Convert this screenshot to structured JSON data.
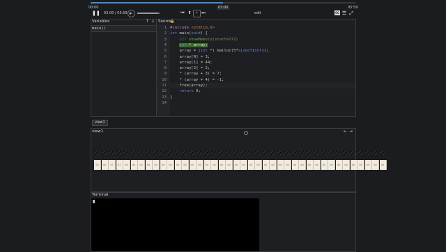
{
  "player": {
    "time_start": "00:00",
    "time_end": "05:59",
    "current_marker": "03:00",
    "time_display": "03:00 / 05:59",
    "progress": 0.5,
    "volume": 0.9,
    "mode_label": "edit",
    "cc_label": "CC"
  },
  "variables": {
    "title": "Variables",
    "items": [
      "main()"
    ]
  },
  "source": {
    "title": "Source",
    "lines": [
      {
        "n": "1",
        "html": "<span class='inc'>#include</span> <span class='str'>&lt;stdlib.h&gt;</span>",
        "text": "#include <stdlib.h>"
      },
      {
        "n": "2",
        "html": "<span class='kw'>int</span> main(<span class='kw'>void</span>) {",
        "text": "int main(void) {"
      },
      {
        "n": "3",
        "html": "    <span class='cm'>//! showMemory(start=272)</span>",
        "text": "//! showMemory(start=272)"
      },
      {
        "n": "4",
        "html": "    <span class='hl'><span class='kw'>int</span> * array;</span>",
        "text": "int * array;"
      },
      {
        "n": "5",
        "html": "    array = (<span class='kw'>int</span> *) malloc(<span class='num'>5</span>*<span class='kw'>sizeof</span>(<span class='kw'>int</span>));",
        "text": "array = (int *) malloc(5*sizeof(int));"
      },
      {
        "n": "6",
        "html": "    array[<span class='num'>0</span>] = <span class='num'>3</span>;",
        "text": "array[0] = 3;"
      },
      {
        "n": "7",
        "html": "    array[<span class='num'>1</span>] = <span class='num'>44</span>;",
        "text": "array[1] = 44;"
      },
      {
        "n": "8",
        "html": "    array[<span class='num'>2</span>] = <span class='num'>2</span>;",
        "text": "array[2] = 2;"
      },
      {
        "n": "9",
        "html": "    * (array + <span class='num'>3</span>) = <span class='num'>7</span>;",
        "text": "* (array + 3) = 7;"
      },
      {
        "n": "10",
        "html": "    * (array + <span class='num'>4</span>) = <span class='num'>-1</span>;",
        "text": "* (array + 4) = -1;"
      },
      {
        "n": "11",
        "html": "    free(array);",
        "text": "free(array);"
      },
      {
        "n": "12",
        "html": "    <span class='kw'>return</span> <span class='num'>0</span>;",
        "text": "return 0;"
      },
      {
        "n": "13",
        "html": "}",
        "text": "}"
      },
      {
        "n": "14",
        "html": "",
        "text": ""
      }
    ]
  },
  "view_tab": "view1",
  "view_panel": {
    "title": "view1",
    "cells": [
      "00",
      "00",
      "07",
      "01",
      "00",
      "00",
      "00",
      "00",
      "00",
      "00",
      "00",
      "00",
      "00",
      "00",
      "00",
      "00",
      "00",
      "00",
      "00",
      "00",
      "00",
      "00",
      "00",
      "00",
      "00",
      "00",
      "00",
      "00",
      "00",
      "00",
      "00",
      "00",
      "00",
      "00",
      "00",
      "00",
      "00",
      "00",
      "00",
      "00"
    ]
  },
  "terminal": {
    "title": "Terminal"
  },
  "colors": {
    "accent": "#4a8ad6",
    "highlight": "#3b6b2b",
    "memory_cell": "#f1ebe0"
  }
}
